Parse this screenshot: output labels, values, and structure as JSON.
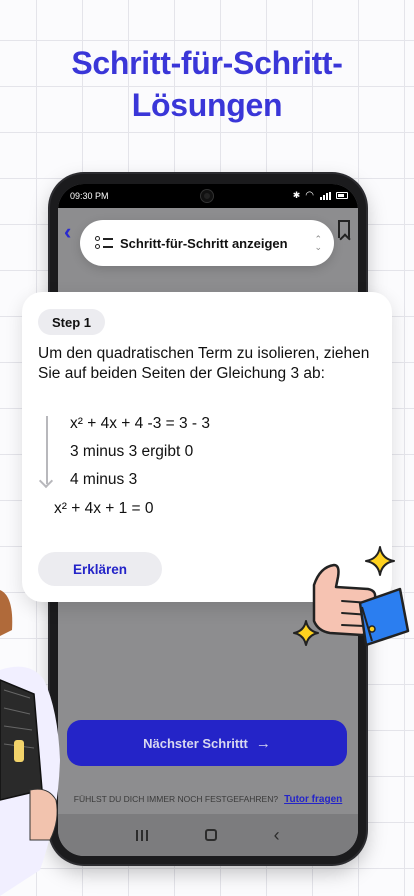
{
  "headline": {
    "line1": "Schritt-für-Schritt-",
    "line2": "Lösungen"
  },
  "phone": {
    "status_time": "09:30 PM",
    "mode_select": {
      "label": "Schritt-für-Schritt anzeigen",
      "icon": "list-icon"
    },
    "step": {
      "badge": "Step 1",
      "instruction": "Um den quadratischen Term zu isolieren, ziehen Sie auf beiden Seiten der Gleichung 3 ab:",
      "working": [
        "x² + 4x + 4 -3 = 3 - 3",
        "3 minus 3 ergibt 0",
        "4 minus 3"
      ],
      "result": "x² + 4x + 1 = 0",
      "explain_label": "Erklären"
    },
    "next_button_label": "Nächster Schrittt",
    "help_text": "FÜHLST DU DICH IMMER NOCH FESTGEFAHREN?",
    "tutor_link": "Tutor fragen"
  },
  "colors": {
    "accent": "#3a36d8",
    "button": "#2424c8",
    "screen_overlay": "#8d8d8f",
    "sparkle": "#ffd21f",
    "cuff": "#2b7ef0"
  }
}
